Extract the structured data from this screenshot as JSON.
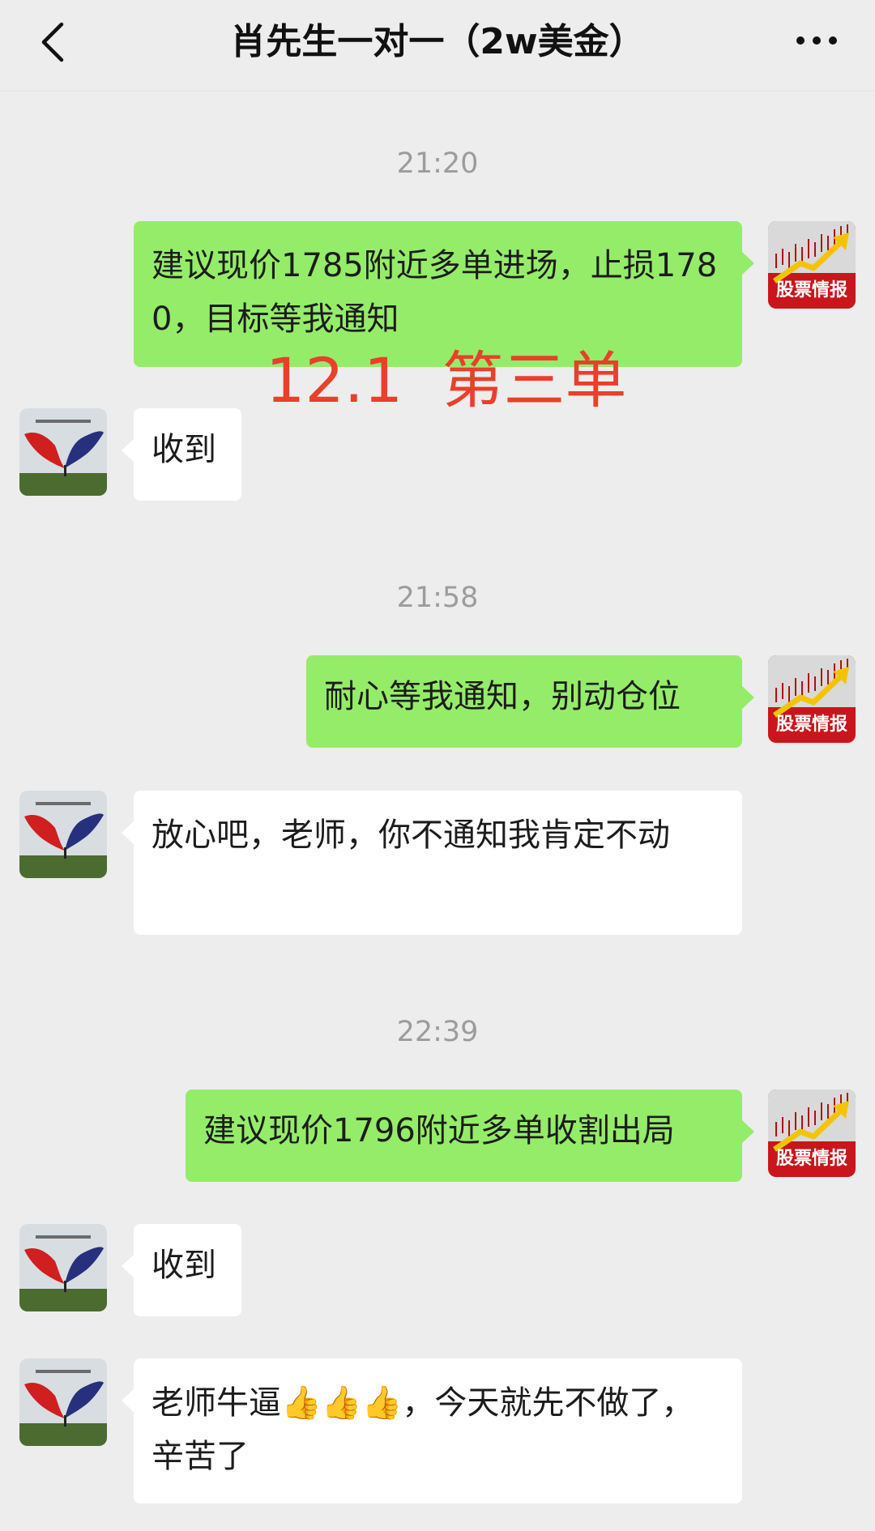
{
  "header": {
    "title": "肖先生一对一（2w美金）",
    "back_icon": "chevron-left-icon",
    "more_icon": "ellipsis-icon"
  },
  "overlay_text": "12.1  第三单",
  "sender_avatar_label": "股票情报",
  "colors": {
    "out_bubble": "#95ec69",
    "in_bubble": "#ffffff",
    "background": "#ededed",
    "overlay": "#e8402a"
  },
  "messages": [
    {
      "type": "time",
      "text": "21:20"
    },
    {
      "type": "out",
      "text": "建议现价1785附近多单进场，止损1780，目标等我通知"
    },
    {
      "type": "in",
      "text": "收到"
    },
    {
      "type": "time",
      "text": "21:58"
    },
    {
      "type": "out",
      "text": "耐心等我通知，别动仓位"
    },
    {
      "type": "in",
      "text": "放心吧，老师，你不通知我肯定不动"
    },
    {
      "type": "time",
      "text": "22:39"
    },
    {
      "type": "out",
      "text": "建议现价1796附近多单收割出局"
    },
    {
      "type": "in",
      "text": "收到"
    },
    {
      "type": "in",
      "text": "老师牛逼👍👍👍，今天就先不做了，辛苦了"
    }
  ]
}
